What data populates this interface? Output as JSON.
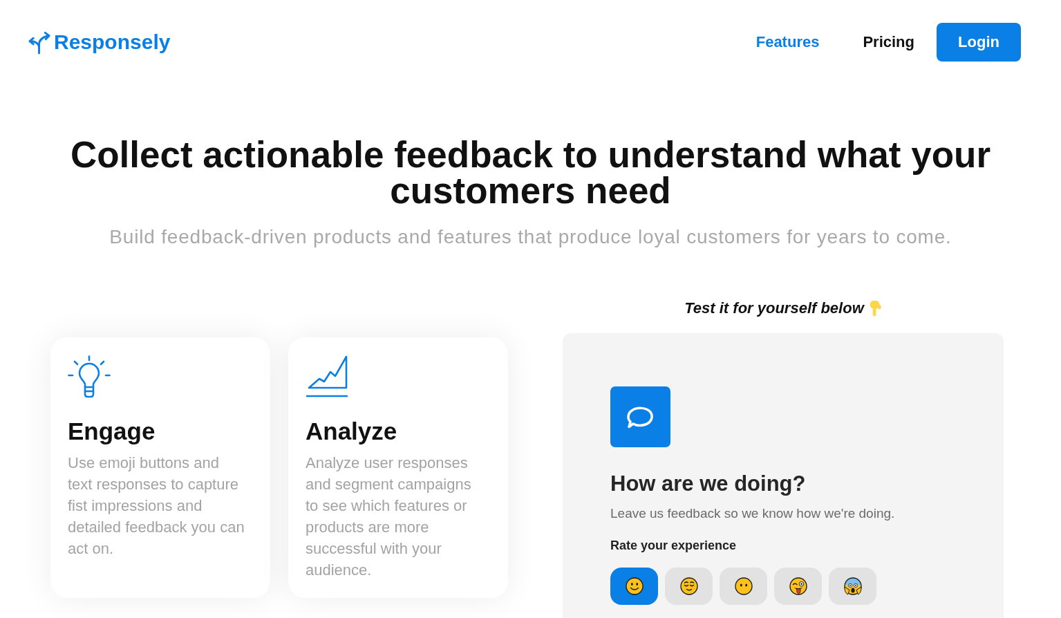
{
  "header": {
    "logo": "Responsely",
    "nav": [
      {
        "label": "Features",
        "selected": true
      },
      {
        "label": "Pricing",
        "selected": false
      }
    ],
    "login_button": "Login"
  },
  "hero": {
    "title": "Collect actionable feedback to understand what your customers need",
    "subtitle": "Build feedback-driven products and features that produce loyal customers for years to come."
  },
  "features": [
    {
      "title": "Engage",
      "description": "Use emoji buttons and text responses to capture fist impressions and detailed feedback you can act on."
    },
    {
      "title": "Analyze",
      "description": "Analyze user responses and segment campaigns to see which features or products are more successful with your audience."
    }
  ],
  "demo": {
    "prompt": "Test it for yourself below",
    "widget": {
      "title": "How are we doing?",
      "subtitle": "Leave us feedback so we know how we're doing.",
      "rating_label": "Rate your experience",
      "ratings": [
        {
          "selected": true
        },
        {
          "selected": false
        },
        {
          "selected": false
        },
        {
          "selected": false
        },
        {
          "selected": false
        }
      ]
    }
  }
}
